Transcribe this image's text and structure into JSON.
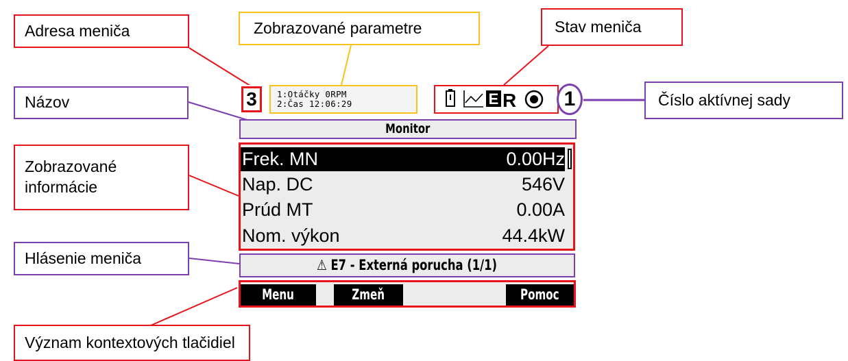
{
  "callouts": {
    "address": "Adresa meniča",
    "params": "Zobrazované parametre",
    "status": "Stav meniča",
    "title": "Názov",
    "set": "Číslo aktívnej sady",
    "info": "Zobrazované\ninformácie",
    "message": "Hlásenie meniča",
    "buttons": "Význam kontextových tlačidiel"
  },
  "display": {
    "address": "3",
    "param_line1": "1:Otáčky 0RPM",
    "param_line2": "2:Čas 12:06:29",
    "status_icons": [
      "battery-icon",
      "trend-icon",
      "e-box-icon",
      "r-letter-icon",
      "record-circle-icon"
    ],
    "status_r": "R",
    "status_e": "E",
    "active_set": "1",
    "title": "Monitor",
    "rows": [
      {
        "label": "Frek. MN",
        "value": "0.00Hz",
        "selected": true
      },
      {
        "label": "Nap. DC",
        "value": "546V"
      },
      {
        "label": "Prúd MT",
        "value": "0.00A"
      },
      {
        "label": "Nom. výkon",
        "value": "44.4kW"
      }
    ],
    "message_icon": "⚠",
    "message": "E7 - Externá porucha (1/1)",
    "softkeys": {
      "left": "Menu",
      "middle": "Zmeň",
      "right": "Pomoc"
    }
  },
  "colors": {
    "red": "#e8141b",
    "yellow": "#f7c21c",
    "purple": "#7b3fb0"
  }
}
